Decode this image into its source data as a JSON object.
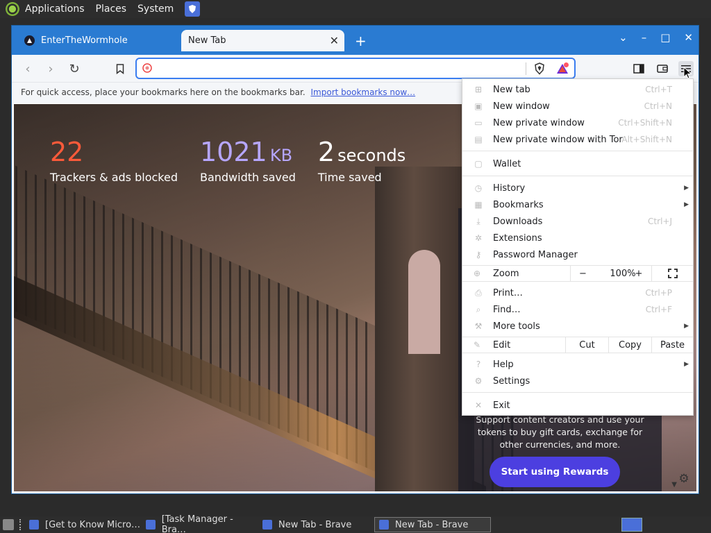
{
  "top_panel": {
    "menus": [
      "Applications",
      "Places",
      "System"
    ]
  },
  "window": {
    "tabs": [
      {
        "title": "EnterTheWormhole",
        "active": false
      },
      {
        "title": "New Tab",
        "active": true
      }
    ],
    "new_tab_glyph": "+",
    "controls": {
      "chevron": "⌄",
      "minimize": "–",
      "maximize": "□",
      "close": "✕"
    }
  },
  "toolbar": {
    "back_icon": "back-arrow-icon",
    "address_value": "",
    "address_placeholder": ""
  },
  "bookmarks_bar": {
    "hint": "For quick access, place your bookmarks here on the bookmarks bar.",
    "import_link": "Import bookmarks now…"
  },
  "ntp": {
    "stats": [
      {
        "value": "22",
        "unit": "",
        "label": "Trackers & ads blocked"
      },
      {
        "value": "1021",
        "unit": "KB",
        "label": "Bandwidth saved"
      },
      {
        "value": "2",
        "unit": "seconds",
        "label": "Time saved"
      }
    ],
    "rewards_text": "Support content creators and use your tokens to buy gift cards, exchange for other currencies, and more.",
    "rewards_button": "Start using Rewards"
  },
  "app_menu": {
    "group1": [
      {
        "label": "New tab",
        "shortcut": "Ctrl+T"
      },
      {
        "label": "New window",
        "shortcut": "Ctrl+N"
      },
      {
        "label": "New private window",
        "shortcut": "Ctrl+Shift+N"
      },
      {
        "label": "New private window with Tor",
        "shortcut": "Alt+Shift+N"
      }
    ],
    "wallet": "Wallet",
    "group2": [
      {
        "label": "History",
        "shortcut": "",
        "submenu": true
      },
      {
        "label": "Bookmarks",
        "shortcut": "",
        "submenu": true
      },
      {
        "label": "Downloads",
        "shortcut": "Ctrl+J",
        "submenu": false
      },
      {
        "label": "Extensions",
        "shortcut": "",
        "submenu": false
      },
      {
        "label": "Password Manager",
        "shortcut": "",
        "submenu": false
      }
    ],
    "zoom": {
      "label": "Zoom",
      "minus": "−",
      "value": "100%",
      "plus": "+"
    },
    "group3": [
      {
        "label": "Print…",
        "shortcut": "Ctrl+P",
        "submenu": false
      },
      {
        "label": "Find…",
        "shortcut": "Ctrl+F",
        "submenu": false
      },
      {
        "label": "More tools",
        "shortcut": "",
        "submenu": true
      }
    ],
    "edit": {
      "label": "Edit",
      "cut": "Cut",
      "copy": "Copy",
      "paste": "Paste"
    },
    "group4": [
      {
        "label": "Help",
        "submenu": true
      },
      {
        "label": "Settings",
        "submenu": false
      }
    ],
    "exit": "Exit"
  },
  "taskbar": {
    "tasks": [
      {
        "title": "[Get to Know Micro…",
        "active": false
      },
      {
        "title": "[Task Manager - Bra…",
        "active": false
      },
      {
        "title": "New Tab - Brave",
        "active": false
      },
      {
        "title": "New Tab - Brave",
        "active": true
      }
    ]
  },
  "colors": {
    "tabstrip": "#2a7bd2",
    "accent": "#3a7df0",
    "trackers": "#fb5a3a",
    "bandwidth": "#b6a6ff",
    "rewards_button": "#4c3fe0"
  }
}
